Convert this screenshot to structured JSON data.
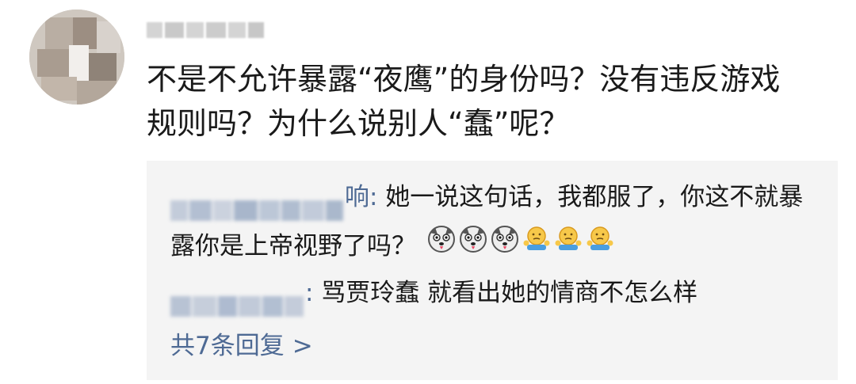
{
  "comment": {
    "text_line1": "不是不允许暴露“夜鹰”的身份吗？没有违反游戏",
    "text_line2": "规则吗？为什么说别人“蠢”呢？"
  },
  "replies": [
    {
      "author_visible_tail": "响",
      "separator": ":",
      "text": " 她一说这句话，我都服了，你这不就暴露你是上帝视野了吗？",
      "emojis": [
        "husky-face-icon",
        "husky-face-icon",
        "husky-face-icon",
        "shrug-face-icon",
        "shrug-face-icon",
        "shrug-face-icon"
      ]
    },
    {
      "author_visible_tail": "",
      "separator": ":",
      "text": " 骂贾玲蠢 就看出她的情商不怎么样"
    }
  ],
  "more_replies": {
    "label": "共7条回复",
    "chevron": ">"
  },
  "colors": {
    "text": "#1a1a1a",
    "link": "#4e6a94",
    "reply_bg": "#f4f4f4"
  }
}
